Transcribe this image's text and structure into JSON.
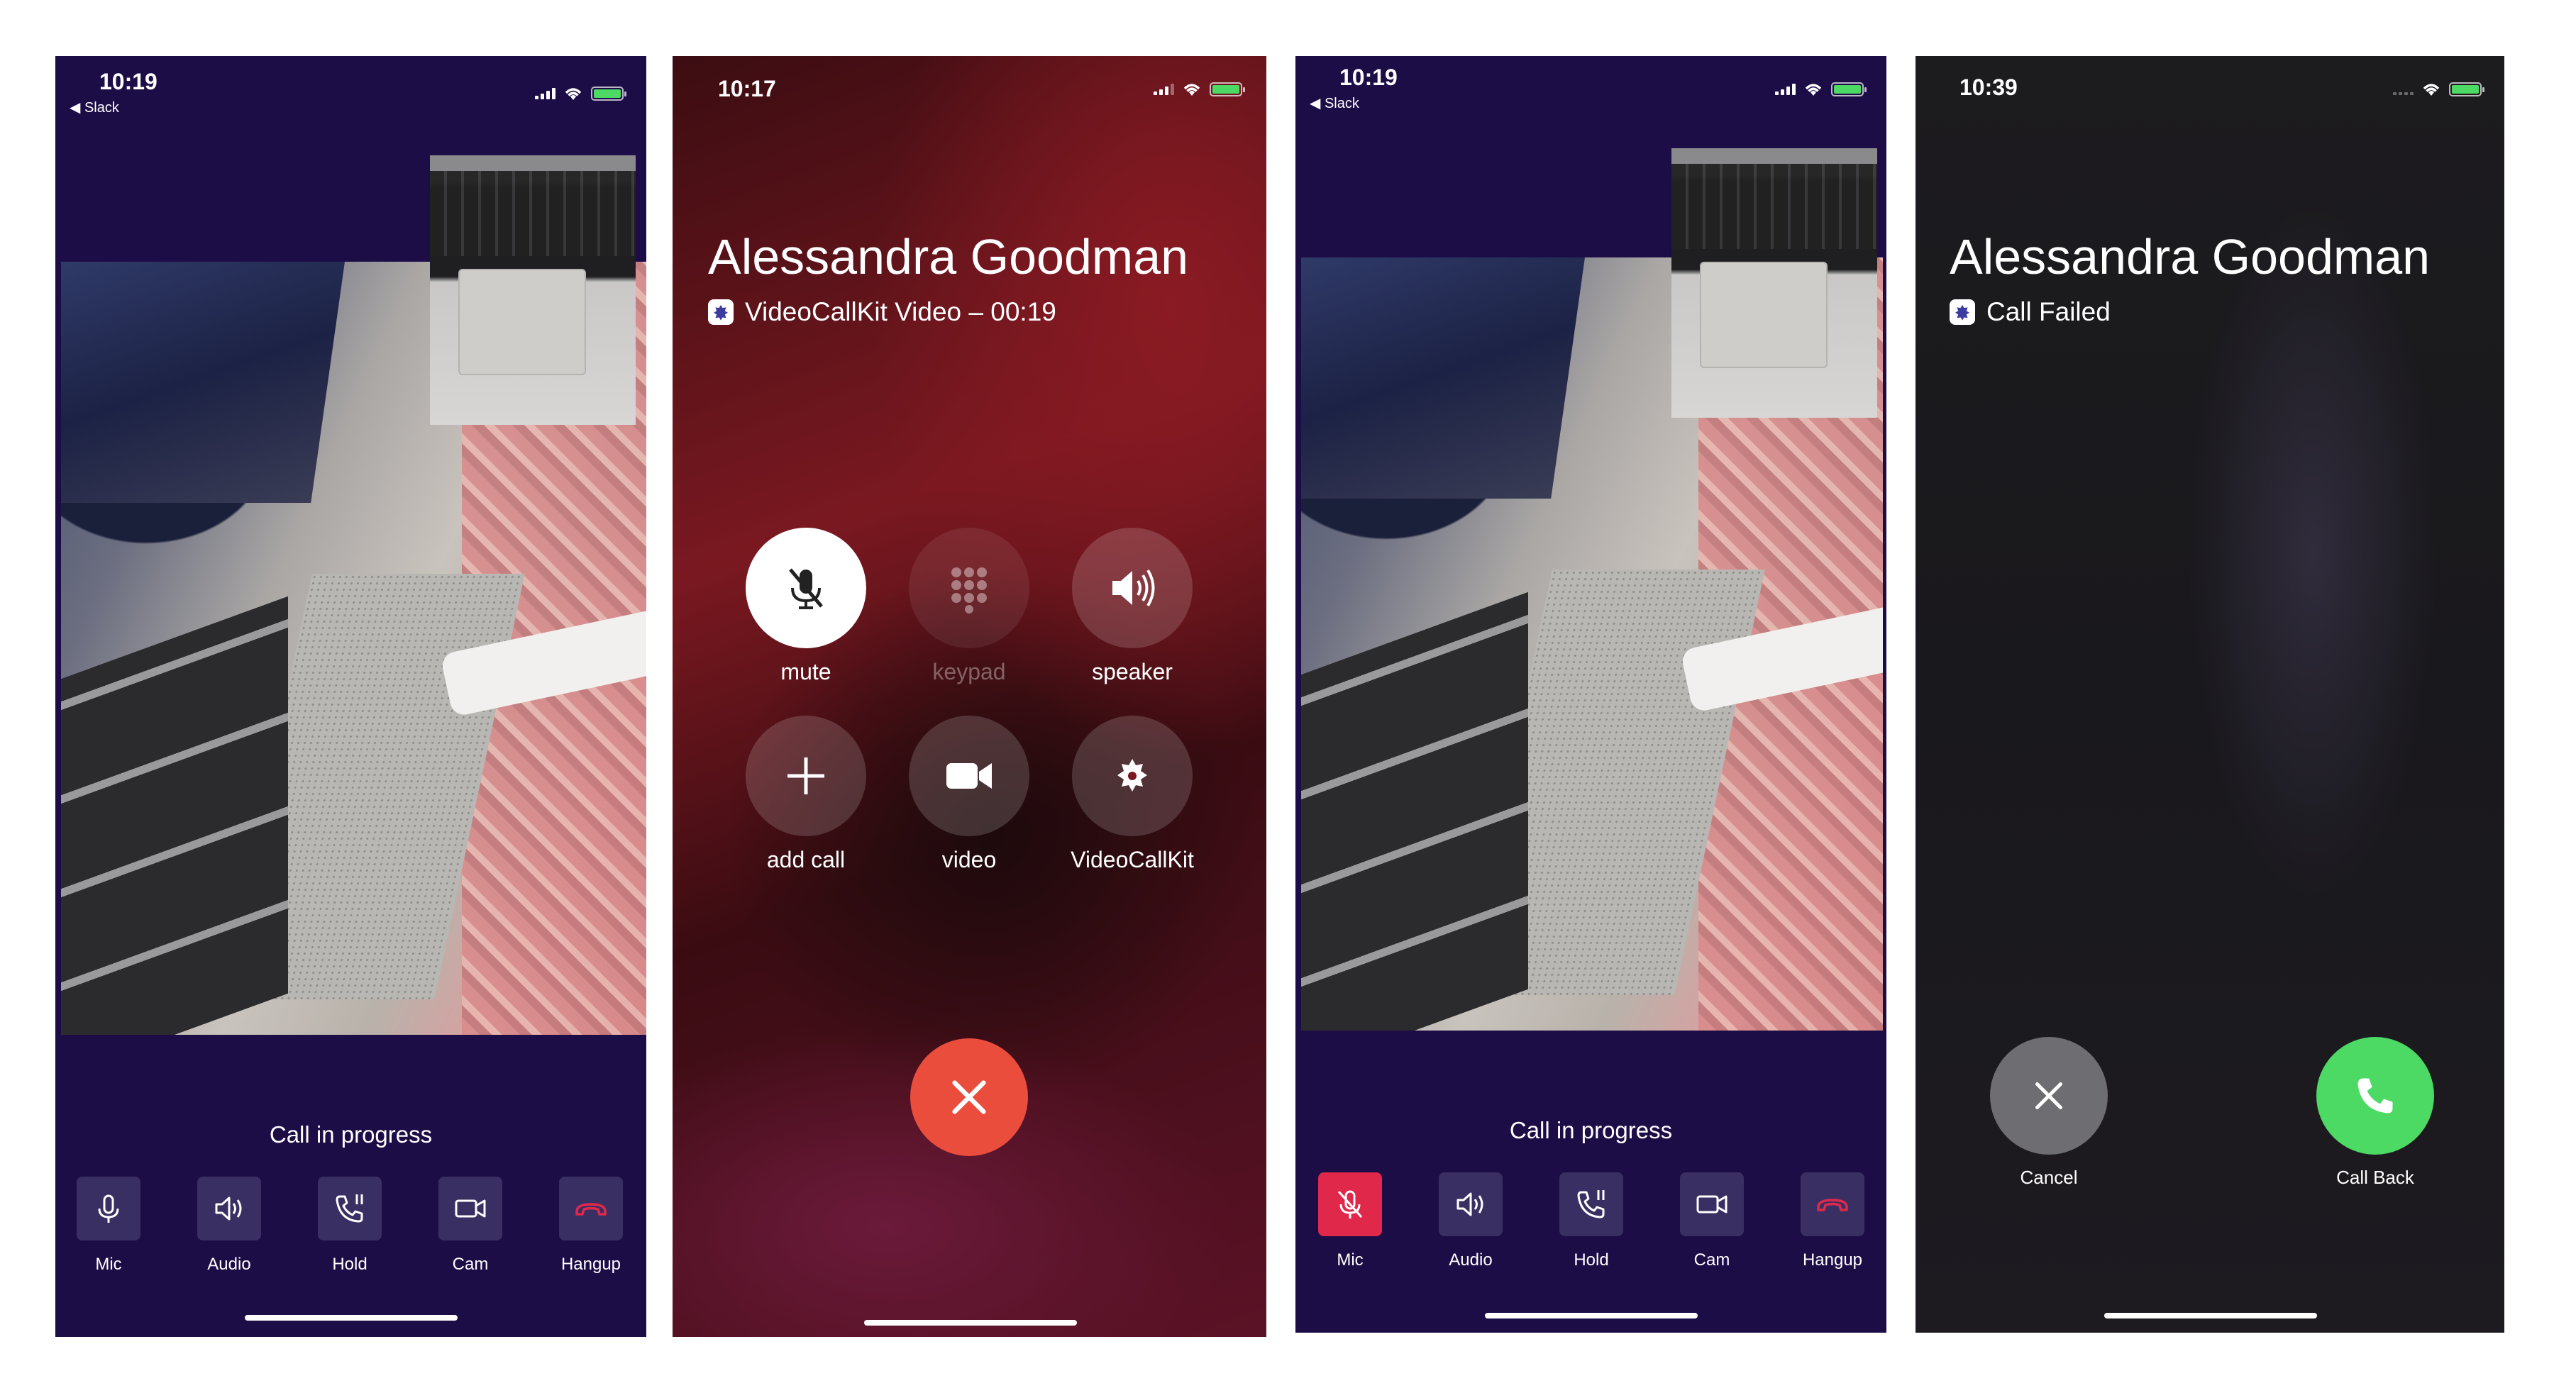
{
  "screen1": {
    "time": "10:19",
    "back_app": "◀ Slack",
    "status": "Call in progress",
    "controls": [
      {
        "label": "Mic",
        "icon": "mic-icon"
      },
      {
        "label": "Audio",
        "icon": "speaker-icon"
      },
      {
        "label": "Hold",
        "icon": "phone-pause-icon"
      },
      {
        "label": "Cam",
        "icon": "camera-icon"
      },
      {
        "label": "Hangup",
        "icon": "hangup-icon"
      }
    ]
  },
  "screen2": {
    "time": "10:17",
    "caller": "Alessandra Goodman",
    "subtitle": "VideoCallKit Video – 00:19",
    "buttons": [
      {
        "label": "mute",
        "icon": "mic-off-icon",
        "state": "on"
      },
      {
        "label": "keypad",
        "icon": "keypad-icon",
        "state": "disabled"
      },
      {
        "label": "speaker",
        "icon": "speaker-icon",
        "state": "off"
      },
      {
        "label": "add call",
        "icon": "plus-icon",
        "state": "off"
      },
      {
        "label": "video",
        "icon": "video-icon",
        "state": "off"
      },
      {
        "label": "VideoCallKit",
        "icon": "app-icon",
        "state": "off"
      }
    ],
    "end_icon": "close-icon"
  },
  "screen3": {
    "time": "10:19",
    "back_app": "◀ Slack",
    "status": "Call in progress",
    "controls": [
      {
        "label": "Mic",
        "icon": "mic-off-icon",
        "active": true
      },
      {
        "label": "Audio",
        "icon": "speaker-icon"
      },
      {
        "label": "Hold",
        "icon": "phone-pause-icon"
      },
      {
        "label": "Cam",
        "icon": "camera-icon"
      },
      {
        "label": "Hangup",
        "icon": "hangup-icon"
      }
    ]
  },
  "screen4": {
    "time": "10:39",
    "caller": "Alessandra Goodman",
    "subtitle": "Call Failed",
    "cancel_label": "Cancel",
    "callback_label": "Call Back"
  },
  "colors": {
    "slack_bg": "#1d0d47",
    "control_bg": "#3a2f63",
    "hangup_red": "#e0284a",
    "end_red": "#eb4d3d",
    "callback_green": "#4cd964"
  }
}
